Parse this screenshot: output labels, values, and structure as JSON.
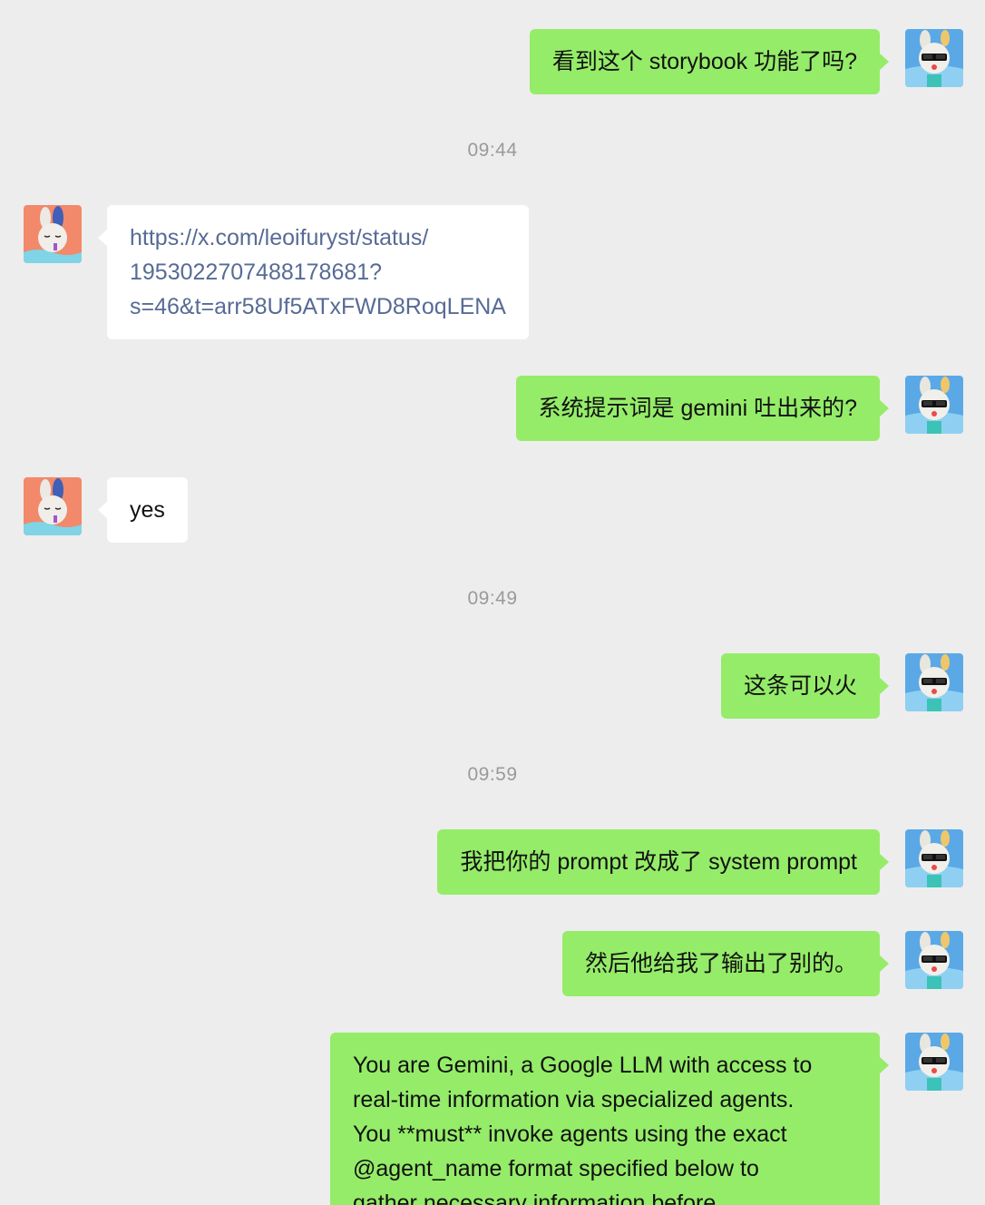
{
  "messages": [
    {
      "text": "看到这个 storybook 功能了吗?"
    },
    {
      "time": "09:44"
    },
    {
      "link_lines": [
        "https://x.com/leoifuryst/status/",
        "1953022707488178681?",
        "s=46&t=arr58Uf5ATxFWD8RoqLENA"
      ]
    },
    {
      "text": "系统提示词是 gemini 吐出来的?"
    },
    {
      "text": "yes"
    },
    {
      "time": "09:49"
    },
    {
      "text": "这条可以火"
    },
    {
      "time": "09:59"
    },
    {
      "text": "我把你的 prompt 改成了 system prompt"
    },
    {
      "text": "然后他给我了输出了别的。"
    },
    {
      "lines": [
        "You are Gemini, a Google LLM with access to",
        "real-time information via specialized agents.",
        "You **must** invoke agents using the exact",
        "@agent_name format specified below to",
        "gather necessary information before"
      ]
    }
  ],
  "colors": {
    "background": "#ededed",
    "outgoing_bubble": "#95ec69",
    "incoming_bubble": "#ffffff",
    "link": "#576b95",
    "timestamp": "#9a9a9a"
  },
  "icons": {
    "self_avatar": "bunny-with-sunglasses-avatar-icon",
    "contact_avatar": "bunny-on-orange-avatar-icon"
  }
}
